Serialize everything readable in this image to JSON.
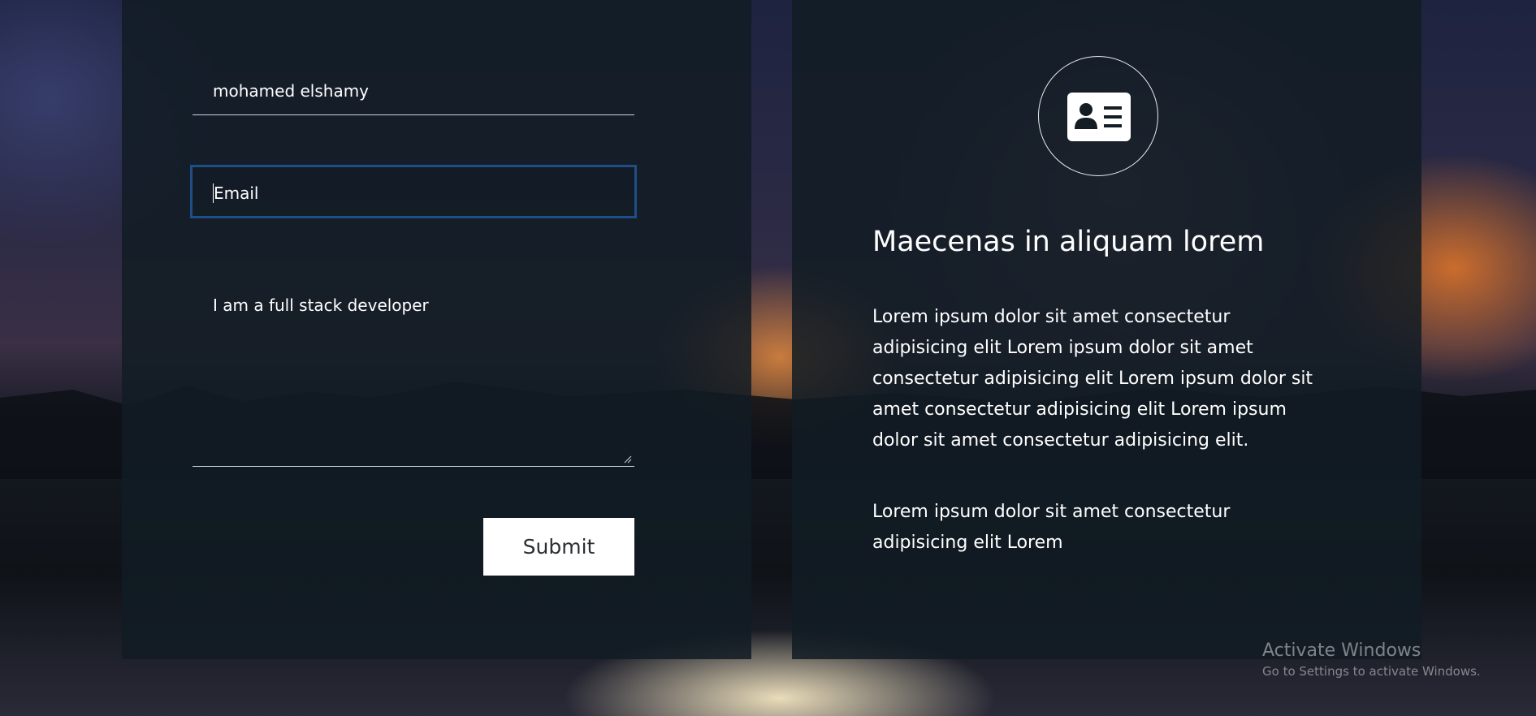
{
  "form": {
    "name_value": "mohamed elshamy",
    "email_placeholder": "Email",
    "message_value": "I am a full stack developer",
    "submit_label": "Submit",
    "focus_color": "#1f4e86"
  },
  "info": {
    "icon": "contact-card-icon",
    "title": "Maecenas in aliquam lorem",
    "paragraph_1": "Lorem ipsum dolor sit amet consectetur adipisicing elit Lorem ipsum dolor sit amet consectetur adipisicing elit Lorem ipsum dolor sit amet consectetur adipisicing elit Lorem ipsum dolor sit amet consectetur adipisicing elit.",
    "paragraph_2": "Lorem ipsum dolor sit amet consectetur adipisicing elit Lorem"
  },
  "watermark": {
    "line_1": "Activate Windows",
    "line_2": "Go to Settings to activate Windows."
  }
}
